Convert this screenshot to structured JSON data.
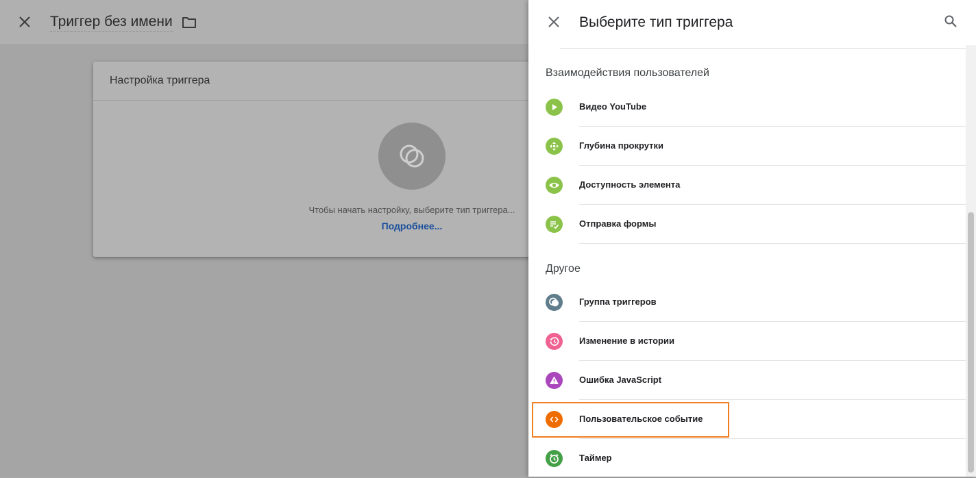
{
  "background": {
    "title": "Триггер без имени",
    "card": {
      "title": "Настройка триггера",
      "hint": "Чтобы начать настройку, выберите тип триггера...",
      "link": "Подробнее..."
    }
  },
  "panel": {
    "title": "Выберите тип триггера",
    "sections": [
      {
        "title": "Взаимодействия пользователей",
        "items": [
          {
            "label": "Видео YouTube",
            "icon": "play-icon",
            "color": "#8bc34a"
          },
          {
            "label": "Глубина прокрутки",
            "icon": "scroll-arrows-icon",
            "color": "#8bc34a"
          },
          {
            "label": "Доступность элемента",
            "icon": "eye-icon",
            "color": "#8bc34a"
          },
          {
            "label": "Отправка формы",
            "icon": "form-check-icon",
            "color": "#8bc34a"
          }
        ]
      },
      {
        "title": "Другое",
        "items": [
          {
            "label": "Группа триггеров",
            "icon": "trigger-group-icon",
            "color": "#607d8b"
          },
          {
            "label": "Изменение в истории",
            "icon": "history-icon",
            "color": "#f06292"
          },
          {
            "label": "Ошибка JavaScript",
            "icon": "warning-icon",
            "color": "#ab47bc"
          },
          {
            "label": "Пользовательское событие",
            "icon": "code-icon",
            "color": "#ef6c00",
            "highlighted": true
          },
          {
            "label": "Таймер",
            "icon": "alarm-icon",
            "color": "#43a047"
          }
        ]
      }
    ]
  }
}
